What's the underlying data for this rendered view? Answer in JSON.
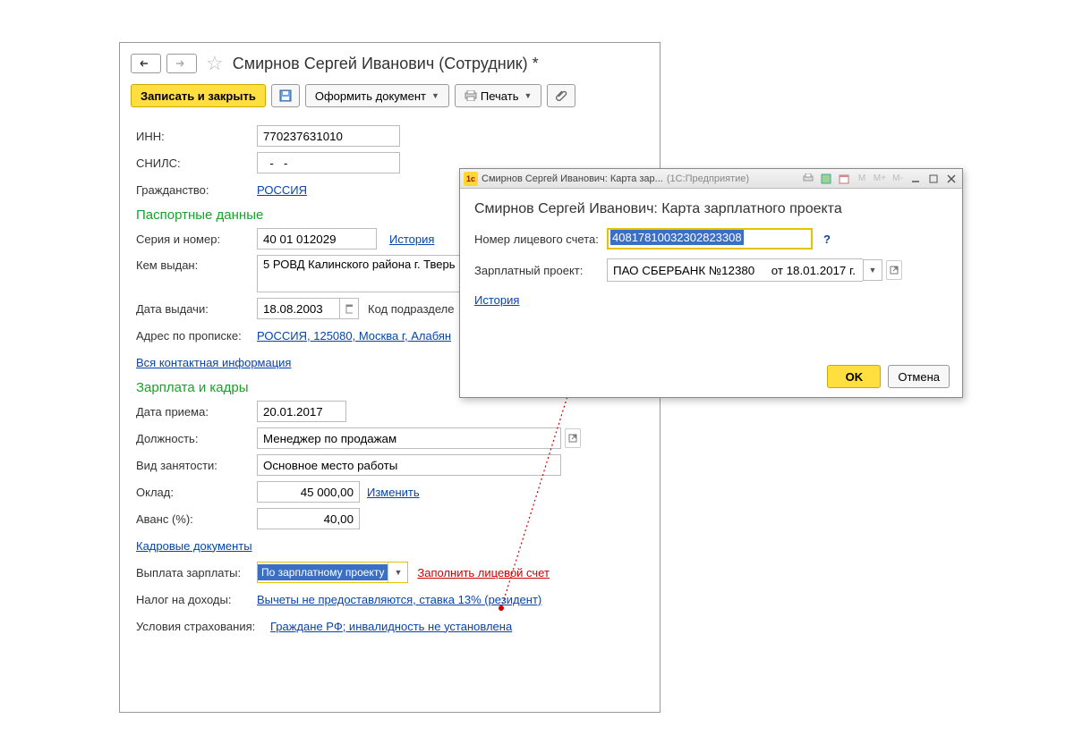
{
  "main": {
    "title": "Смирнов Сергей Иванович (Сотрудник) *",
    "toolbar": {
      "save_close": "Записать и закрыть",
      "create_doc": "Оформить документ",
      "print": "Печать"
    },
    "inn_label": "ИНН:",
    "inn": "770237631010",
    "snils_label": "СНИЛС:",
    "snils": "  -   -",
    "citizenship_label": "Гражданство:",
    "citizenship": "РОССИЯ",
    "passport_section": "Паспортные данные",
    "serial_label": "Серия и номер:",
    "serial": "40 01 012029",
    "history": "История",
    "issued_by_label": "Кем выдан:",
    "issued_by": "5 РОВД Калинского района г. Тверь",
    "issue_date_label": "Дата выдачи:",
    "issue_date": "18.08.2003",
    "dept_code_label": "Код подразделе",
    "address_label": "Адрес по прописке:",
    "address": "РОССИЯ, 125080, Москва г, Алабян",
    "all_contacts": "Вся контактная информация",
    "salary_section": "Зарплата и кадры",
    "hire_date_label": "Дата приема:",
    "hire_date": "20.01.2017",
    "position_label": "Должность:",
    "position": "Менеджер по продажам",
    "employment_label": "Вид занятости:",
    "employment": "Основное место работы",
    "salary_label": "Оклад:",
    "salary": "45 000,00",
    "change": "Изменить",
    "advance_label": "Аванс (%):",
    "advance": "40,00",
    "hr_docs": "Кадровые документы",
    "payment_label": "Выплата зарплаты:",
    "payment_value": "По зарплатному проекту",
    "fill_account": "Заполнить лицевой счет",
    "tax_label": "Налог на доходы:",
    "tax_text": "Вычеты не предоставляются, ставка 13% (резидент)",
    "insurance_label": "Условия страхования:",
    "insurance_text": "Граждане РФ; инвалидность не установлена"
  },
  "popup": {
    "title_short": "Смирнов Сергей Иванович: Карта зар...",
    "title_suffix": "(1С:Предприятие)",
    "title": "Смирнов Сергей Иванович: Карта зарплатного проекта",
    "account_label": "Номер лицевого счета:",
    "account": "40817810032302823308",
    "project_label": "Зарплатный проект:",
    "project": "ПАО СБЕРБАНК №12380     от 18.01.2017 г.",
    "history": "История",
    "ok": "OK",
    "cancel": "Отмена",
    "m": "M",
    "m_plus": "M+",
    "m_minus": "M-"
  }
}
